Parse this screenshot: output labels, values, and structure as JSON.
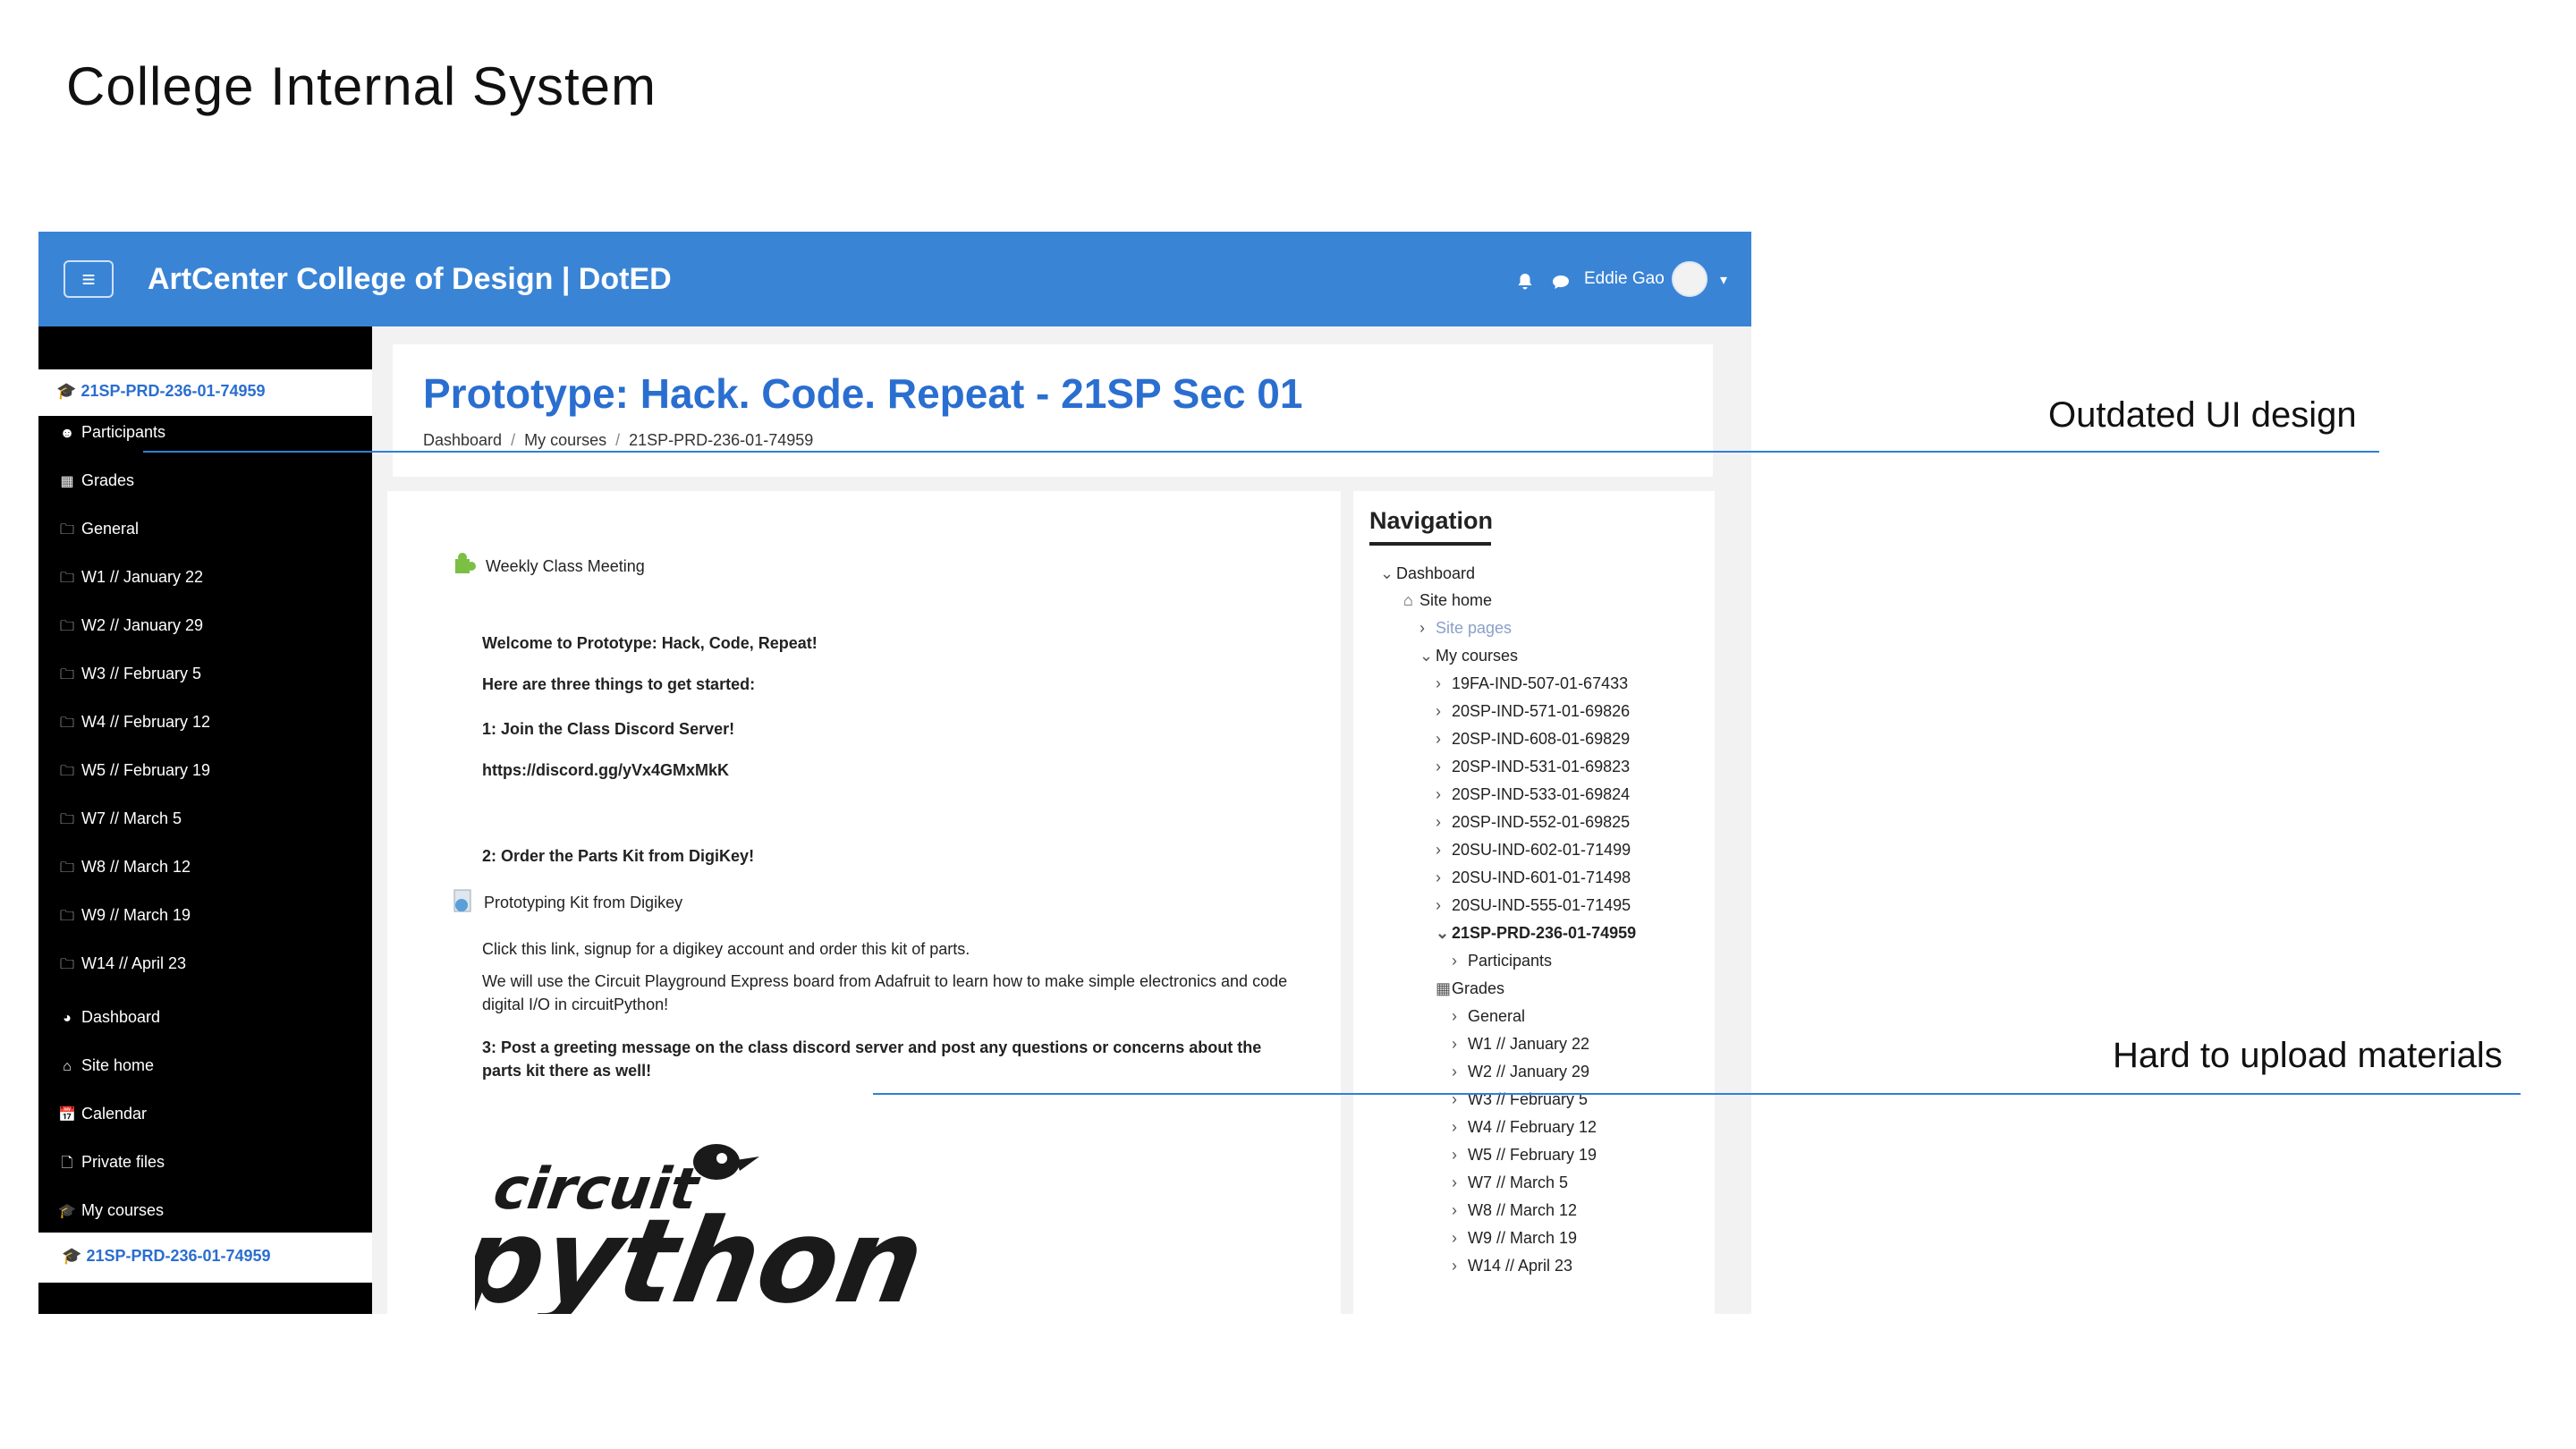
{
  "slide": {
    "title": "College Internal System"
  },
  "topbar": {
    "menu_icon": "hamburger-icon",
    "brand": "ArtCenter College of Design | DotED",
    "user_name": "Eddie Gao",
    "color": "#3a84d6"
  },
  "sidebar": {
    "course_code": "21SP-PRD-236-01-74959",
    "items": [
      {
        "label": "Participants",
        "icon": "users-icon"
      },
      {
        "label": "Grades",
        "icon": "table-icon"
      },
      {
        "label": "General",
        "icon": "folder-icon"
      },
      {
        "label": "W1 // January 22",
        "icon": "folder-icon"
      },
      {
        "label": "W2 // January 29",
        "icon": "folder-icon"
      },
      {
        "label": "W3 // February 5",
        "icon": "folder-icon"
      },
      {
        "label": "W4 // February 12",
        "icon": "folder-icon"
      },
      {
        "label": "W5 // February 19",
        "icon": "folder-icon"
      },
      {
        "label": "W7 // March 5",
        "icon": "folder-icon"
      },
      {
        "label": "W8 // March 12",
        "icon": "folder-icon"
      },
      {
        "label": "W9 // March 19",
        "icon": "folder-icon"
      },
      {
        "label": "W14 // April 23",
        "icon": "folder-icon"
      },
      {
        "label": "Dashboard",
        "icon": "dashboard-icon"
      },
      {
        "label": "Site home",
        "icon": "home-icon"
      },
      {
        "label": "Calendar",
        "icon": "calendar-icon"
      },
      {
        "label": "Private files",
        "icon": "file-icon"
      },
      {
        "label": "My courses",
        "icon": "graduation-cap-icon"
      }
    ],
    "bottom_course": "21SP-PRD-236-01-74959"
  },
  "header": {
    "title": "Prototype: Hack. Code. Repeat - 21SP Sec 01",
    "breadcrumbs": [
      "Dashboard",
      "My courses",
      "21SP-PRD-236-01-74959"
    ]
  },
  "main": {
    "meeting": "Weekly Class Meeting",
    "welcome": "Welcome to Prototype: Hack, Code, Repeat!",
    "intro": "Here are three things to get started:",
    "step1": "1: Join the Class Discord Server!",
    "discord_link": "https://discord.gg/yVx4GMxMkK",
    "step2": "2: Order the Parts Kit from DigiKey!",
    "kit_link": "Prototyping Kit from Digikey",
    "kit_desc": "Click this link, signup for a digikey account and order this kit of parts.",
    "board_desc_1": "We will use the Circuit Playground Express board from Adafruit to learn how to make simple electronics and code",
    "board_desc_2": "digital I/O in circuitPython!",
    "step3_1": "3: Post a greeting message on the class discord server and post any questions or concerns about the",
    "step3_2": "parts kit there as well!",
    "logo_top": "circuit",
    "logo_bottom": "python"
  },
  "navigation": {
    "title": "Navigation",
    "dashboard": "Dashboard",
    "site_home": "Site home",
    "site_pages": "Site pages",
    "my_courses": "My courses",
    "courses": [
      "19FA-IND-507-01-67433",
      "20SP-IND-571-01-69826",
      "20SP-IND-608-01-69829",
      "20SP-IND-531-01-69823",
      "20SP-IND-533-01-69824",
      "20SP-IND-552-01-69825",
      "20SU-IND-602-01-71499",
      "20SU-IND-601-01-71498",
      "20SU-IND-555-01-71495"
    ],
    "current_course": "21SP-PRD-236-01-74959",
    "participants": "Participants",
    "grades": "Grades",
    "sections": [
      "General",
      "W1 // January 22",
      "W2 // January 29",
      "W3 // February 5",
      "W4 // February 12",
      "W5 // February 19",
      "W7 // March 5",
      "W8 // March 12",
      "W9 // March 19",
      "W14 // April 23"
    ]
  },
  "annotations": {
    "ui": "Outdated UI design",
    "upload": "Hard to upload materials",
    "line_color": "#2f7fd9"
  }
}
